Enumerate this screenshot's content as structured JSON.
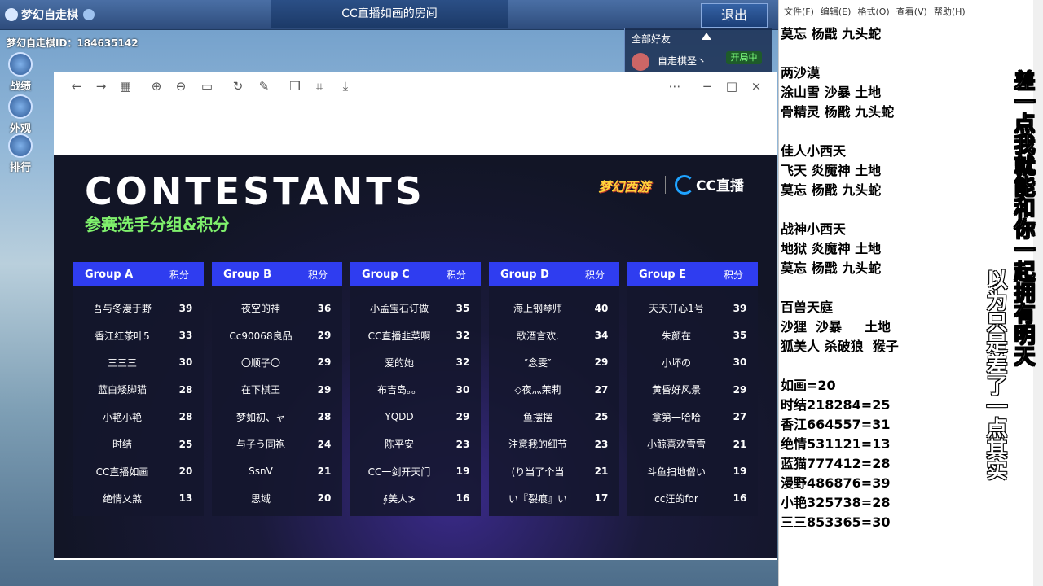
{
  "game": {
    "logo": "梦幻自走棋",
    "room_title": "CC直播如画的房间",
    "exit_label": "退出",
    "player_id": "梦幻自走棋ID：184635142",
    "side_buttons": [
      "战绩",
      "外观",
      "排行"
    ],
    "friends_title": "全部好友",
    "friend_name": "自走棋圣丶",
    "friend_status": "开局中"
  },
  "viewer": {
    "toolbar_icons": [
      "back-icon",
      "forward-icon",
      "grid-icon",
      "zoom-in-icon",
      "zoom-out-icon",
      "fit-icon",
      "rotate-icon",
      "edit-icon",
      "copy-icon",
      "crop-icon",
      "save-icon",
      "more-icon",
      "minimize-icon",
      "maximize-icon",
      "close-icon"
    ],
    "title": "CONTESTANTS",
    "subtitle": "参赛选手分组&积分",
    "brand_game": "梦幻西游",
    "brand_cc": "CC直播",
    "score_header": "积分",
    "groups": [
      {
        "name": "Group A",
        "players": [
          {
            "n": "吾与冬漫于野",
            "s": "39"
          },
          {
            "n": "香江红茶叶5",
            "s": "33"
          },
          {
            "n": "三三三",
            "s": "30"
          },
          {
            "n": "蓝白矮脚猫",
            "s": "28"
          },
          {
            "n": "小艳小艳",
            "s": "28"
          },
          {
            "n": "时结",
            "s": "25"
          },
          {
            "n": "CC直播如画",
            "s": "20"
          },
          {
            "n": "绝情乂煞",
            "s": "13"
          }
        ]
      },
      {
        "name": "Group B",
        "players": [
          {
            "n": "夜空的神",
            "s": "36"
          },
          {
            "n": "Cc90068良品",
            "s": "29"
          },
          {
            "n": "〇顺子〇",
            "s": "29"
          },
          {
            "n": "在下棋王",
            "s": "29"
          },
          {
            "n": "梦如初、ャ",
            "s": "28"
          },
          {
            "n": "与子う同袍",
            "s": "24"
          },
          {
            "n": "SsnV",
            "s": "21"
          },
          {
            "n": "思域",
            "s": "20"
          }
        ]
      },
      {
        "name": "Group C",
        "players": [
          {
            "n": "小孟宝石订做",
            "s": "35"
          },
          {
            "n": "CC直播韭菜啊",
            "s": "32"
          },
          {
            "n": "爱的她",
            "s": "32"
          },
          {
            "n": "布吉岛。。",
            "s": "30"
          },
          {
            "n": "YQDD",
            "s": "29"
          },
          {
            "n": "陈平安",
            "s": "23"
          },
          {
            "n": "CC一剑开天门",
            "s": "19"
          },
          {
            "n": "∮美人≯",
            "s": "16"
          }
        ]
      },
      {
        "name": "Group D",
        "players": [
          {
            "n": "海上钢琴师",
            "s": "40"
          },
          {
            "n": "歌酒言欢.",
            "s": "34"
          },
          {
            "n": "″念雯″",
            "s": "29"
          },
          {
            "n": "◇夜灬茉莉",
            "s": "27"
          },
          {
            "n": "鱼摆摆",
            "s": "25"
          },
          {
            "n": "注意我的细节",
            "s": "23"
          },
          {
            "n": "(り当了个当",
            "s": "21"
          },
          {
            "n": "い『裂痕』い",
            "s": "17"
          }
        ]
      },
      {
        "name": "Group E",
        "players": [
          {
            "n": "天天开心1号",
            "s": "39"
          },
          {
            "n": "朱颜在",
            "s": "35"
          },
          {
            "n": "小坏の",
            "s": "30"
          },
          {
            "n": "黄昏好风景",
            "s": "29"
          },
          {
            "n": "拿第一哈哈",
            "s": "27"
          },
          {
            "n": "小鲸喜欢雪雪",
            "s": "21"
          },
          {
            "n": "斗鱼扫地僧い",
            "s": "19"
          },
          {
            "n": "cc汪的for",
            "s": "16"
          }
        ]
      }
    ]
  },
  "notepad": {
    "menu": [
      "文件(F)",
      "编辑(E)",
      "格式(O)",
      "查看(V)",
      "帮助(H)"
    ],
    "lines": [
      "莫忘 杨戬 九头蛇",
      "",
      "两沙漠",
      "涂山雪 沙暴 土地",
      "骨精灵 杨戬 九头蛇",
      "",
      "佳人小西天",
      "飞天 炎魔神 土地",
      "莫忘 杨戬 九头蛇",
      "",
      "战神小西天",
      "地狱 炎魔神 土地",
      "莫忘 杨戬 九头蛇",
      "",
      "百兽天庭",
      "沙狸  沙暴     土地",
      "狐美人 杀破狼  猴子",
      "",
      "如画=20",
      "时结218284=25",
      "香江664557=31",
      "绝情531121=13",
      "蓝猫777412=28",
      "漫野486876=39",
      "小艳325738=28",
      "三三853365=30"
    ],
    "vertical_1": "差一点我就能和你一起拥有明天",
    "vertical_2": "以为只是差了一点其实"
  }
}
